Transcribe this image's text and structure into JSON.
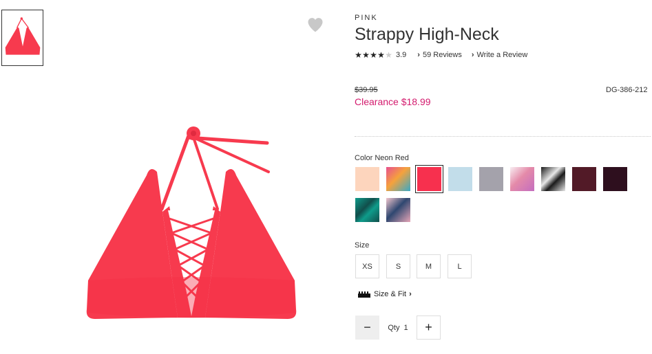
{
  "product": {
    "brand": "PINK",
    "title": "Strappy High-Neck",
    "rating_value": 3.9,
    "rating_display": "3.9",
    "reviews_link": "59 Reviews",
    "write_review_link": "Write a Review",
    "old_price": "$39.95",
    "sale_price": "Clearance $18.99",
    "sku": "DG-386-212"
  },
  "color": {
    "label": "Color",
    "selected_name": "Neon Red",
    "swatches": [
      {
        "name": "peach",
        "colors": [
          "#fdd5bd"
        ]
      },
      {
        "name": "tropical-print",
        "colors": [
          "#e84f8f",
          "#f5a23c",
          "#39a9c7"
        ]
      },
      {
        "name": "neon-red",
        "colors": [
          "#f7304e"
        ],
        "selected": true
      },
      {
        "name": "light-blue",
        "colors": [
          "#c2ddea"
        ]
      },
      {
        "name": "gray",
        "colors": [
          "#a4a2ab"
        ]
      },
      {
        "name": "floral-print",
        "colors": [
          "#f8eef2",
          "#e48aa9",
          "#c46dbf"
        ]
      },
      {
        "name": "palm-print",
        "colors": [
          "#1b1b1b",
          "#e8e8e8"
        ]
      },
      {
        "name": "burgundy",
        "colors": [
          "#521a27"
        ]
      },
      {
        "name": "dark-plum",
        "colors": [
          "#2e0f1e"
        ]
      },
      {
        "name": "teal-print",
        "colors": [
          "#0f9c8b",
          "#114e4b"
        ]
      },
      {
        "name": "leaf-print",
        "colors": [
          "#f2c6ce",
          "#2f4770",
          "#e6a6b7"
        ]
      }
    ]
  },
  "size": {
    "label": "Size",
    "options": [
      "XS",
      "S",
      "M",
      "L"
    ],
    "size_fit_link": "Size & Fit"
  },
  "quantity": {
    "label": "Qty",
    "value": "1",
    "minus_symbol": "−",
    "plus_symbol": "+"
  },
  "icons": {
    "heart": "heart-icon",
    "ruler": "ruler-icon",
    "chevron": "chevron-right-icon",
    "star": "star-icon"
  },
  "colors": {
    "accent": "#d31a6d",
    "product": "#f73a4e",
    "heart": "#c8c8c8"
  }
}
